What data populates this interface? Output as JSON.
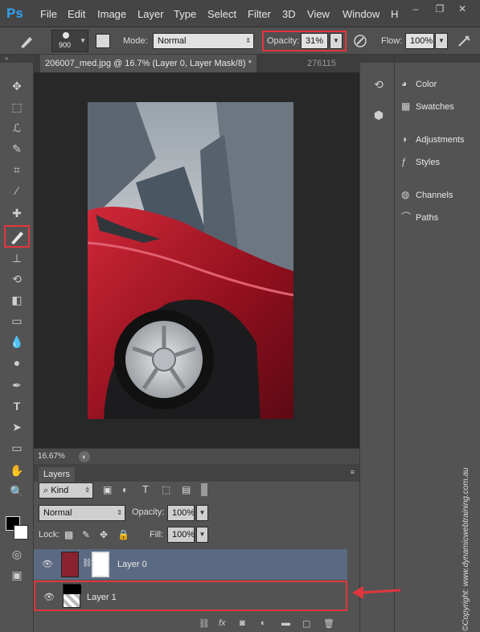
{
  "app": {
    "logo": "Ps"
  },
  "menu": [
    "File",
    "Edit",
    "Image",
    "Layer",
    "Type",
    "Select",
    "Filter",
    "3D",
    "View",
    "Window",
    "H"
  ],
  "options": {
    "brush_size": "900",
    "mode_label": "Mode:",
    "mode_value": "Normal",
    "opacity_label": "Opacity:",
    "opacity_value": "31%",
    "flow_label": "Flow:",
    "flow_value": "100%"
  },
  "tabs": {
    "active": "206007_med.jpg @ 16.7% (Layer 0, Layer Mask/8) *",
    "other": "276115"
  },
  "status": {
    "zoom": "16.67%"
  },
  "right_panel": [
    "Color",
    "Swatches",
    "Adjustments",
    "Styles",
    "Channels",
    "Paths"
  ],
  "layers": {
    "tab": "Layers",
    "kind_value": "Kind",
    "blend_value": "Normal",
    "opacity_label": "Opacity:",
    "opacity_value": "100%",
    "lock_label": "Lock:",
    "fill_label": "Fill:",
    "fill_value": "100%",
    "items": [
      {
        "name": "Layer 0"
      },
      {
        "name": "Layer 1"
      }
    ]
  },
  "watermark": "©Copyright: www.dynamicwebtraining.com.au",
  "colors": {
    "highlight": "#e2363d",
    "selected_layer": "#5a6a82"
  }
}
